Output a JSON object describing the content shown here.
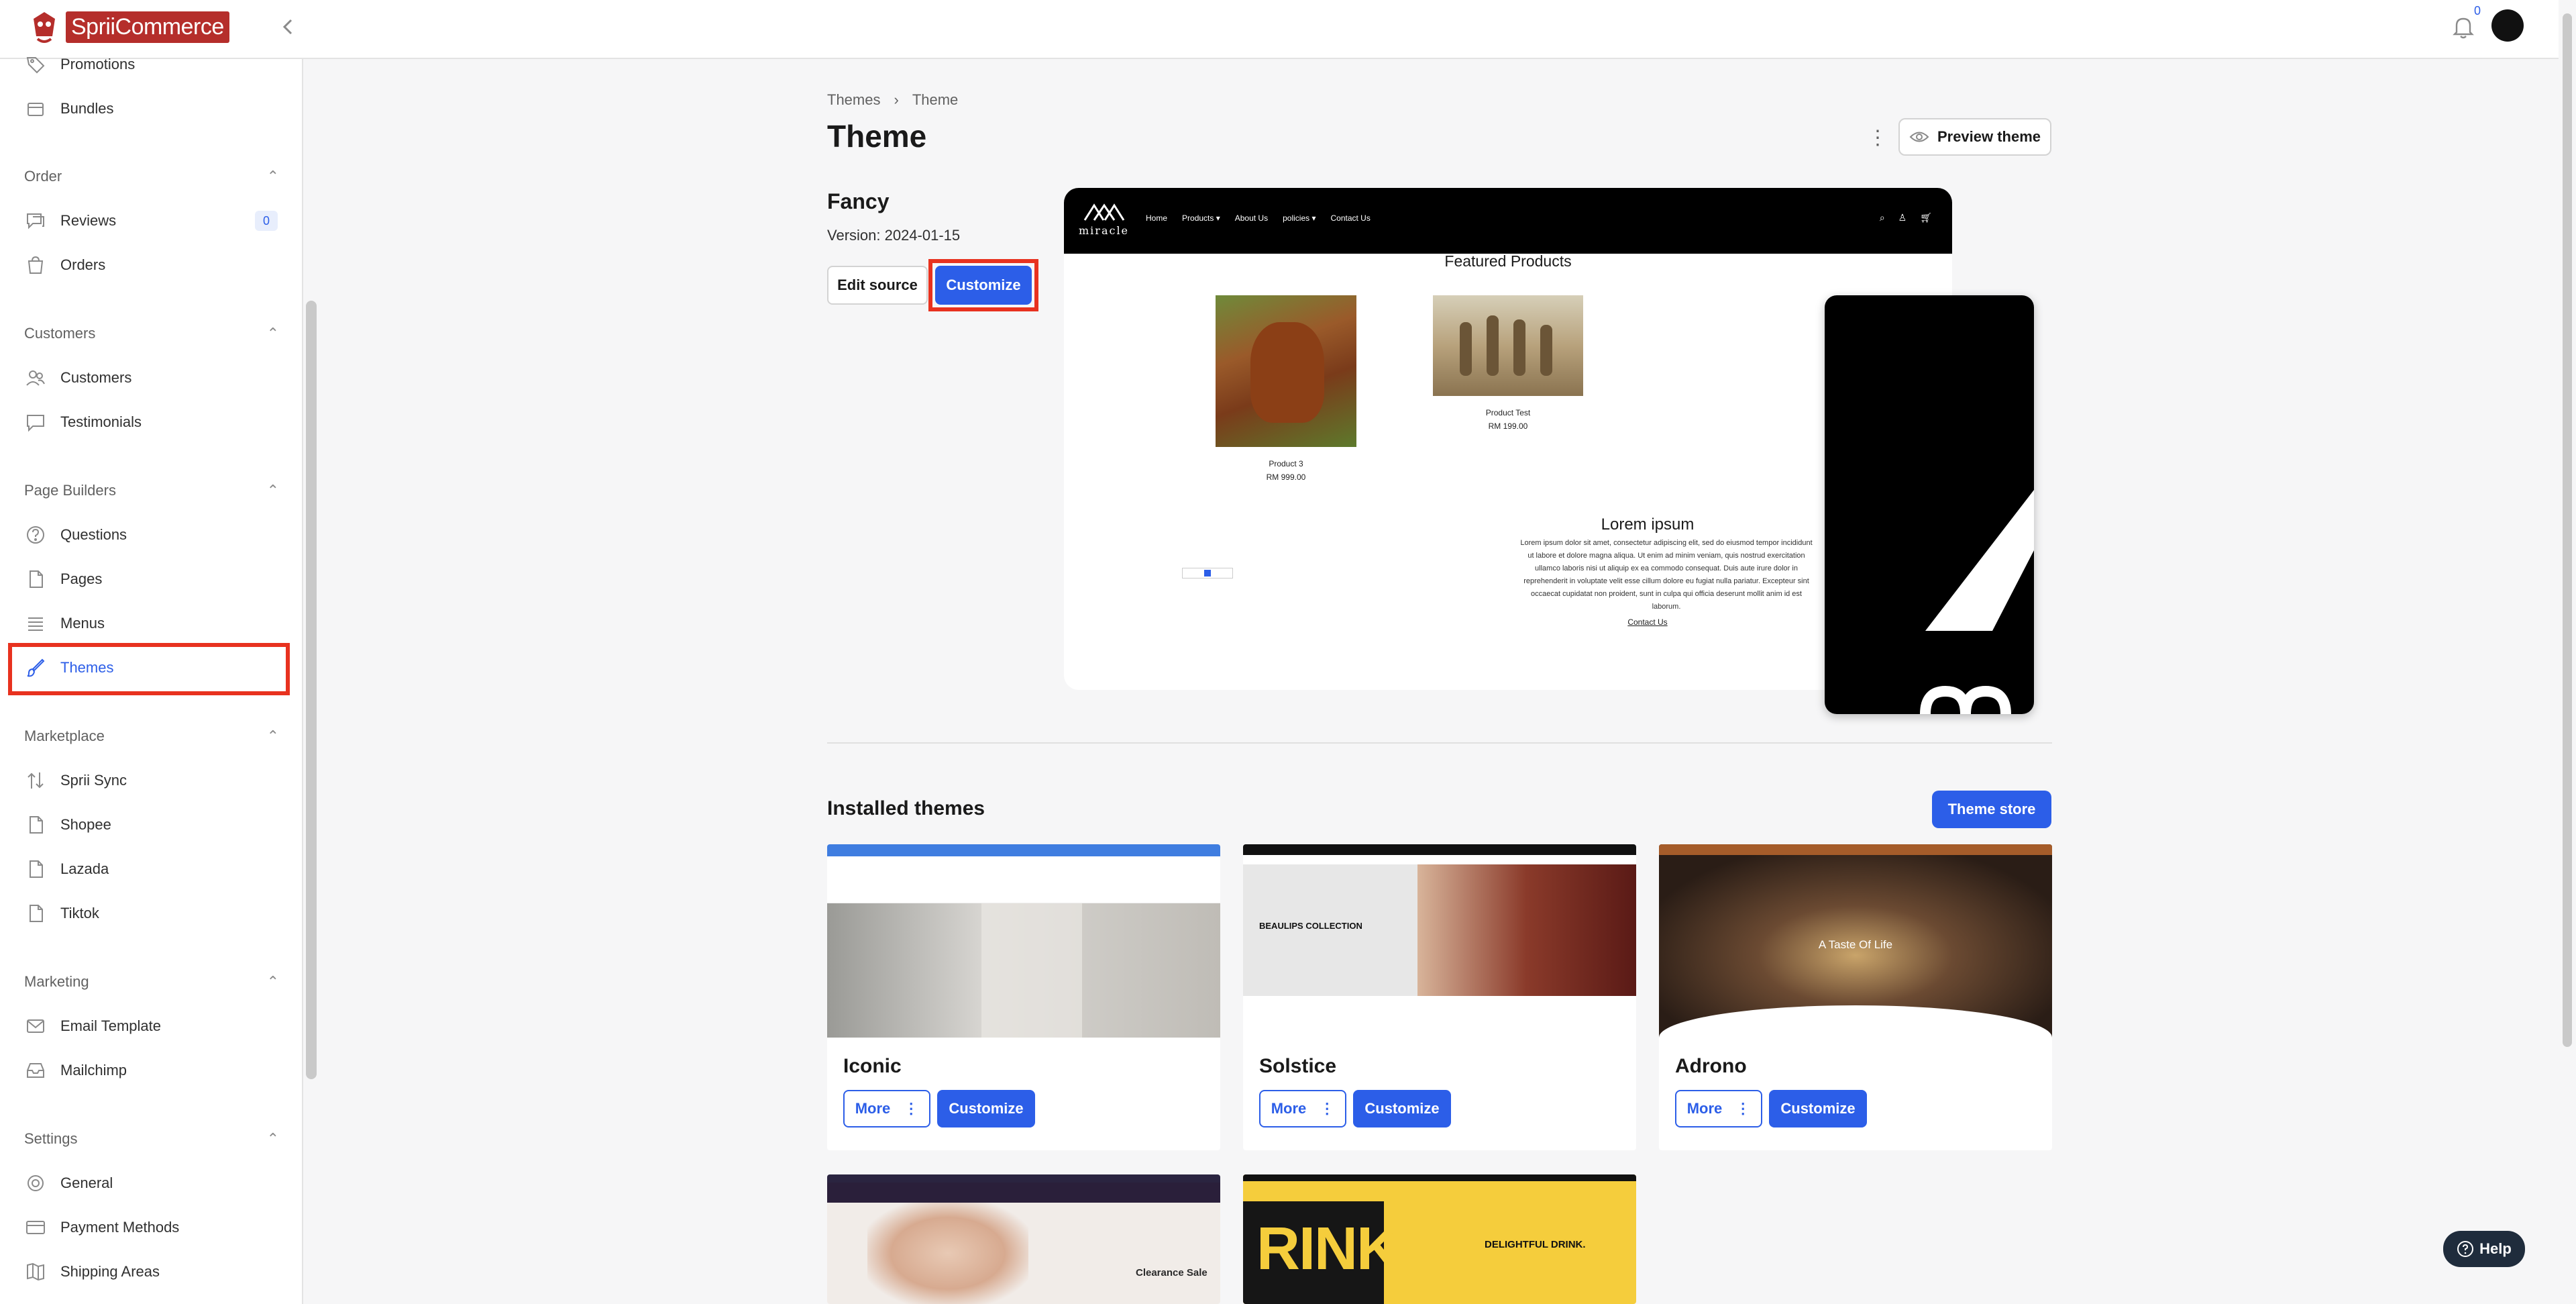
{
  "brand": {
    "logo_text": "SpriiCommerce"
  },
  "topbar": {
    "notification_count": "0"
  },
  "sidebar": {
    "items_top": [
      {
        "label": "Promotions"
      },
      {
        "label": "Bundles"
      }
    ],
    "sections": {
      "order": {
        "title": "Order",
        "items": [
          {
            "label": "Reviews",
            "badge": "0"
          },
          {
            "label": "Orders"
          }
        ]
      },
      "customers": {
        "title": "Customers",
        "items": [
          {
            "label": "Customers"
          },
          {
            "label": "Testimonials"
          }
        ]
      },
      "page_builders": {
        "title": "Page Builders",
        "items": [
          {
            "label": "Questions"
          },
          {
            "label": "Pages"
          },
          {
            "label": "Menus"
          },
          {
            "label": "Themes"
          }
        ]
      },
      "marketplace": {
        "title": "Marketplace",
        "items": [
          {
            "label": "Sprii Sync"
          },
          {
            "label": "Shopee"
          },
          {
            "label": "Lazada"
          },
          {
            "label": "Tiktok"
          }
        ]
      },
      "marketing": {
        "title": "Marketing",
        "items": [
          {
            "label": "Email Template"
          },
          {
            "label": "Mailchimp"
          }
        ]
      },
      "settings": {
        "title": "Settings",
        "items": [
          {
            "label": "General"
          },
          {
            "label": "Payment Methods"
          },
          {
            "label": "Shipping Areas"
          }
        ]
      }
    }
  },
  "breadcrumb": {
    "parent": "Themes",
    "current": "Theme"
  },
  "page": {
    "title": "Theme",
    "preview_label": "Preview theme"
  },
  "current_theme": {
    "name": "Fancy",
    "version": "Version: 2024-01-15",
    "edit_label": "Edit source",
    "customize_label": "Customize"
  },
  "preview": {
    "brand": "miracle",
    "nav_links": [
      "Home",
      "Products ▾",
      "About Us",
      "policies ▾",
      "Contact Us"
    ],
    "featured_title": "Featured Products",
    "products": [
      {
        "name": "Product 3",
        "price": "RM 999.00"
      },
      {
        "name": "Product Test",
        "price": "RM 199.00"
      }
    ],
    "lorem_title": "Lorem ipsum",
    "lorem_body": "Lorem ipsum dolor sit amet, consectetur adipiscing elit, sed do eiusmod tempor incididunt ut labore et dolore magna aliqua. Ut enim ad minim veniam, quis nostrud exercitation ullamco laboris nisi ut aliquip ex ea commodo consequat. Duis aute irure dolor in reprehenderit in voluptate velit esse cillum dolore eu fugiat nulla pariatur. Excepteur sint occaecat cupidatat non proident, sunt in culpa qui officia deserunt mollit anim id est laborum.",
    "contact_link": "Contact Us"
  },
  "installed": {
    "title": "Installed themes",
    "store_label": "Theme store",
    "more_label": "More",
    "customize_label": "Customize",
    "themes": [
      {
        "name": "Iconic"
      },
      {
        "name": "Solstice"
      },
      {
        "name": "Adrono"
      }
    ]
  },
  "help": {
    "label": "Help"
  }
}
